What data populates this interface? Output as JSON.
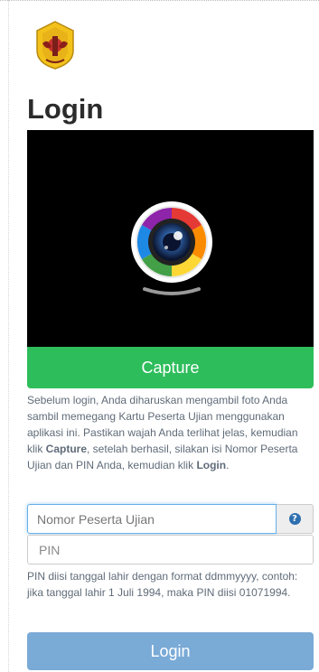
{
  "page": {
    "title": "Login"
  },
  "logo": {
    "icon": "university-seal-logo"
  },
  "camera": {
    "icon": "webcam-lens-icon"
  },
  "capture_button": {
    "label": "Capture",
    "color": "#2dbd5b"
  },
  "instructions": {
    "part1": "Sebelum login, Anda diharuskan mengambil foto Anda sambil memegang Kartu Peserta Ujian menggunakan aplikasi ini. Pastikan wajah Anda terlihat jelas, kemudian klik ",
    "capture_word": "Capture",
    "part2": ", setelah berhasil, silakan isi Nomor Peserta Ujian dan PIN Anda, kemudian klik ",
    "login_word": "Login",
    "part3": "."
  },
  "nomor_field": {
    "placeholder": "Nomor Peserta Ujian",
    "value": ""
  },
  "help": {
    "icon": "question-circle-icon",
    "glyph": "?"
  },
  "pin_field": {
    "placeholder": "PIN",
    "value": ""
  },
  "pin_help": "PIN diisi tanggal lahir dengan format ddmmyyyy, contoh: jika tanggal lahir 1 Juli 1994, maka PIN diisi 01071994.",
  "login_button": {
    "label": "Login",
    "color": "#7aaad6"
  }
}
